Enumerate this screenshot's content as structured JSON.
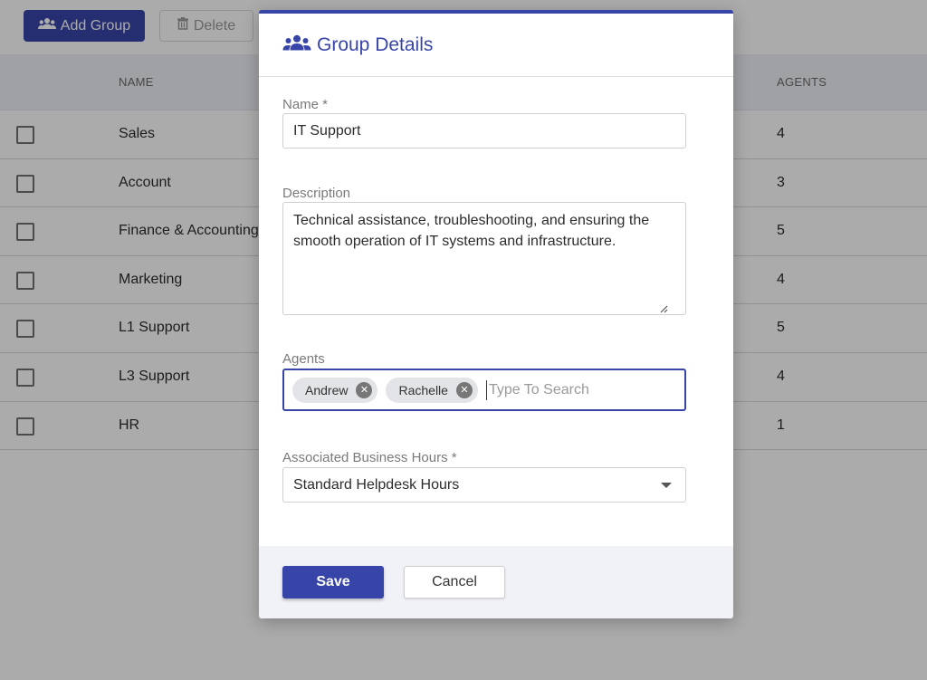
{
  "toolbar": {
    "add_group_label": "Add Group",
    "delete_label": "Delete"
  },
  "table": {
    "columns": {
      "name": "NAME",
      "agents": "AGENTS"
    },
    "rows": [
      {
        "name": "Sales",
        "agents": "4"
      },
      {
        "name": "Account",
        "agents": "3"
      },
      {
        "name": "Finance & Accounting",
        "agents": "5"
      },
      {
        "name": "Marketing",
        "agents": "4"
      },
      {
        "name": "L1 Support",
        "agents": "5"
      },
      {
        "name": "L3 Support",
        "agents": "4"
      },
      {
        "name": "HR",
        "agents": "1"
      }
    ]
  },
  "modal": {
    "title": "Group Details",
    "name_label": "Name *",
    "name_value": "IT Support",
    "description_label": "Description",
    "description_value": "Technical assistance, troubleshooting, and ensuring the smooth operation of IT systems and infrastructure.",
    "agents_label": "Agents",
    "agents": [
      "Andrew",
      "Rachelle"
    ],
    "agents_placeholder": "Type To Search",
    "business_hours_label": "Associated Business Hours *",
    "business_hours_value": "Standard Helpdesk Hours",
    "save_label": "Save",
    "cancel_label": "Cancel"
  },
  "colors": {
    "accent": "#3845a8",
    "overlay": "rgba(0,0,0,0.33)"
  },
  "icons": {
    "title_icon": "users-icon",
    "add_icon": "users-icon",
    "delete_icon": "trash-icon",
    "chip_remove_icon": "close-circle-icon",
    "select_icon": "caret-down-icon"
  }
}
